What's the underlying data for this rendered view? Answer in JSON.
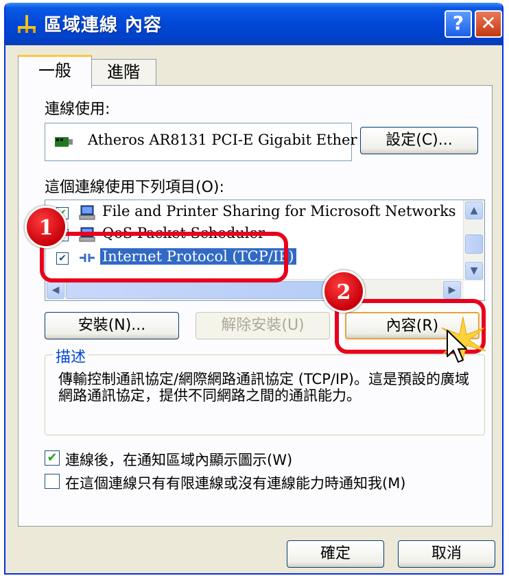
{
  "window": {
    "title": "區域連線 內容",
    "help_label": "?",
    "close_label": "✕"
  },
  "tabs": [
    {
      "label": "一般",
      "active": true
    },
    {
      "label": "進階",
      "active": false
    }
  ],
  "general": {
    "connect_using_label": "連線使用:",
    "adapter_name": "Atheros AR8131 PCI-E Gigabit Ether",
    "configure_button": "設定(C)...",
    "items_label": "這個連線使用下列項目(O):",
    "items": [
      {
        "label": "File and Printer Sharing for Microsoft Networks",
        "checked": true,
        "icon": "network-service-icon"
      },
      {
        "label": "QoS Packet Scheduler",
        "checked": true,
        "icon": "network-service-icon"
      },
      {
        "label": "Internet Protocol (TCP/IP)",
        "checked": true,
        "selected": true,
        "icon": "protocol-icon"
      }
    ],
    "install_button": "安裝(N)...",
    "uninstall_button": "解除安裝(U)",
    "properties_button": "內容(R)",
    "description_title": "描述",
    "description_text": "傳輸控制通訊協定/網際網路通訊協定 (TCP/IP)。這是預設的廣域網路通訊協定，提供不同網路之間的通訊能力。",
    "show_icon_label": "連線後，在通知區域內顯示圖示(W)",
    "show_icon_checked": true,
    "notify_label": "在這個連線只有有限連線或沒有連線能力時通知我(M)",
    "notify_checked": false
  },
  "footer": {
    "ok_button": "確定",
    "cancel_button": "取消"
  },
  "annotations": [
    {
      "number": "1"
    },
    {
      "number": "2"
    }
  ],
  "colors": {
    "titlebar": "#0047d6",
    "selection": "#316ac5",
    "callout": "#e8001c",
    "group_title": "#0046d5"
  }
}
